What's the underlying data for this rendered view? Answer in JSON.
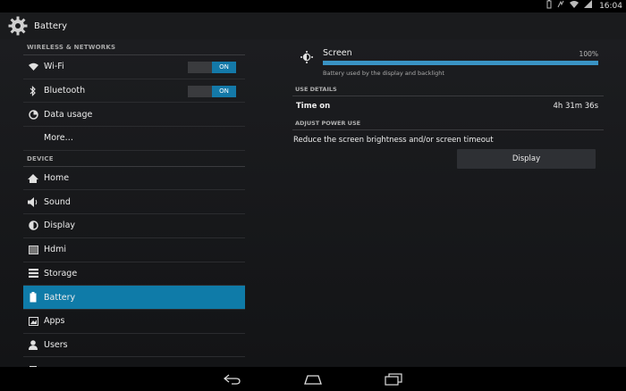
{
  "status_bar": {
    "time": "16:04",
    "icons": [
      "battery-icon",
      "vibrate-icon",
      "wifi-icon",
      "signal-icon"
    ]
  },
  "action_bar": {
    "title": "Battery",
    "icon": "settings-gear-icon"
  },
  "sidebar": {
    "sections": [
      {
        "header": "WIRELESS & NETWORKS",
        "items": [
          {
            "label": "Wi-Fi",
            "icon": "wifi-icon",
            "toggle": "ON"
          },
          {
            "label": "Bluetooth",
            "icon": "bluetooth-icon",
            "toggle": "ON"
          },
          {
            "label": "Data usage",
            "icon": "data-usage-icon"
          },
          {
            "label": "More…",
            "icon": ""
          }
        ]
      },
      {
        "header": "DEVICE",
        "items": [
          {
            "label": "Home",
            "icon": "home-icon"
          },
          {
            "label": "Sound",
            "icon": "speaker-icon"
          },
          {
            "label": "Display",
            "icon": "brightness-icon"
          },
          {
            "label": "Hdmi",
            "icon": "hdmi-icon"
          },
          {
            "label": "Storage",
            "icon": "storage-icon"
          },
          {
            "label": "Battery",
            "icon": "battery-icon",
            "selected": true
          },
          {
            "label": "Apps",
            "icon": "apps-icon"
          },
          {
            "label": "Users",
            "icon": "user-icon"
          }
        ]
      }
    ]
  },
  "detail": {
    "usage_item": {
      "name": "Screen",
      "percent": "100%",
      "fraction": 1.0,
      "subtitle": "Battery used by the display and backlight"
    },
    "use_details_header": "USE DETAILS",
    "time_on_label": "Time on",
    "time_on_value": "4h 31m 36s",
    "adjust_header": "ADJUST POWER USE",
    "adjust_text": "Reduce the screen brightness and/or screen timeout",
    "display_button": "Display"
  },
  "nav_bar": {
    "buttons": [
      "back-icon",
      "home-icon",
      "recents-icon"
    ]
  },
  "colors": {
    "accent": "#0f7ba8",
    "bar_fill": "#3a93c4",
    "background": "#1c1d20"
  }
}
